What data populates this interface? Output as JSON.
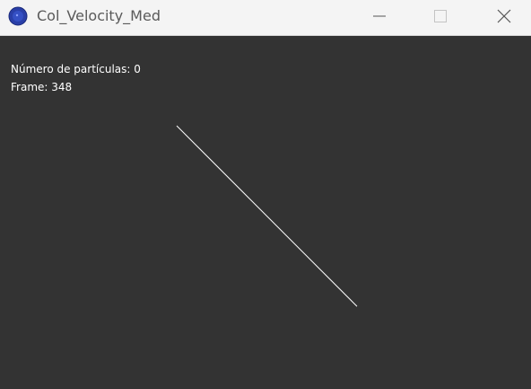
{
  "window": {
    "title": "Col_Velocity_Med",
    "icon": "app-globe-icon",
    "accent_color": "#2a3fa8",
    "background_color": "#333333",
    "titlebar_color": "#f4f4f4"
  },
  "titlebar_controls": {
    "minimize_icon": "minimize-icon",
    "maximize_icon": "maximize-icon",
    "close_icon": "close-icon"
  },
  "hud": {
    "particle_count_label": "Número de partículas: 0",
    "frame_label": "Frame: 348"
  },
  "scene": {
    "line_color": "#ffffff"
  }
}
